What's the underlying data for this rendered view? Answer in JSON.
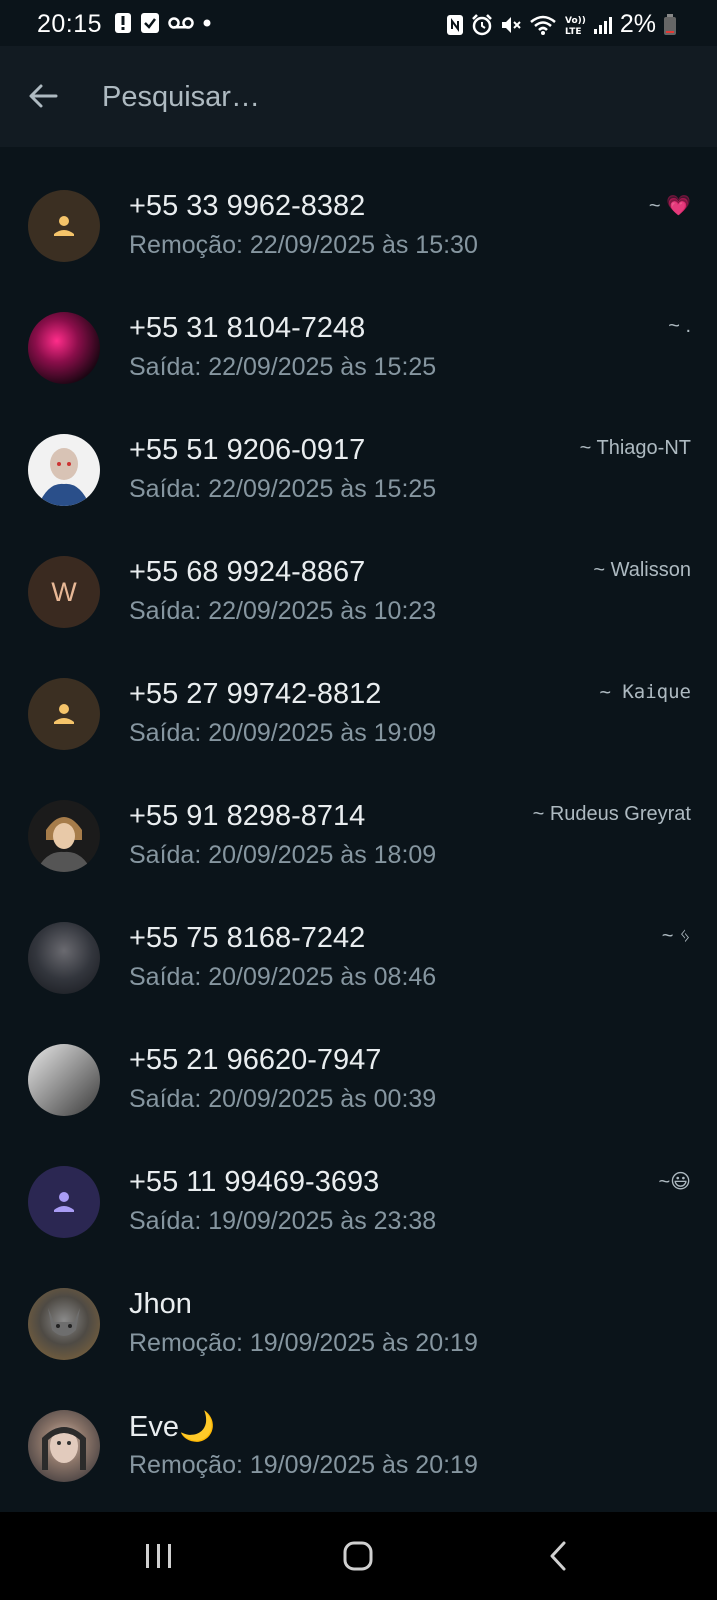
{
  "status_bar": {
    "time": "20:15",
    "battery": "2%",
    "left_icons": [
      "alert-icon",
      "check-box-icon",
      "voicemail-icon",
      "dot-icon"
    ],
    "right_icons": [
      "nfc-icon",
      "alarm-icon",
      "mute-icon",
      "wifi-icon",
      "volte-icon",
      "signal-icon",
      "battery-icon"
    ]
  },
  "search": {
    "placeholder": "Pesquisar…",
    "value": ""
  },
  "contacts": [
    {
      "name": "+55 33 9962-8382",
      "status": "Remoção: 22/09/2025 às 15:30",
      "push_name": "~ 💗",
      "avatar": "default-avatar"
    },
    {
      "name": "+55 31 8104-7248",
      "status": "Saída: 22/09/2025 às 15:25",
      "push_name": "~ .",
      "avatar": "photo-avatar"
    },
    {
      "name": "+55 51 9206-0917",
      "status": "Saída: 22/09/2025 às 15:25",
      "push_name": "~ Thiago-NT",
      "avatar": "photo-avatar"
    },
    {
      "name": "+55 68 9924-8867",
      "status": "Saída: 22/09/2025 às 10:23",
      "push_name": "~ Walisson",
      "avatar": "letter-avatar",
      "letter": "W"
    },
    {
      "name": "+55 27 99742-8812",
      "status": "Saída: 20/09/2025 às 19:09",
      "push_name": "~ Kaique",
      "avatar": "default-avatar"
    },
    {
      "name": "+55 91 8298-8714",
      "status": "Saída: 20/09/2025 às 18:09",
      "push_name": "~ Rudeus Greyrat",
      "avatar": "photo-avatar"
    },
    {
      "name": "+55 75 8168-7242",
      "status": "Saída: 20/09/2025 às 08:46",
      "push_name": "~ ᛃ",
      "avatar": "photo-avatar"
    },
    {
      "name": "+55 21 96620-7947",
      "status": "Saída: 20/09/2025 às 00:39",
      "push_name": "",
      "avatar": "photo-avatar"
    },
    {
      "name": "+55 11 99469-3693",
      "status": "Saída: 19/09/2025 às 23:38",
      "push_name": "~😃",
      "avatar": "default-avatar"
    },
    {
      "name": "Jhon",
      "status": "Remoção: 19/09/2025 às 20:19",
      "push_name": "",
      "avatar": "photo-avatar"
    },
    {
      "name": "Eve🌙",
      "status": "Remoção: 19/09/2025 às 20:19",
      "push_name": "",
      "avatar": "photo-avatar"
    }
  ],
  "colors": {
    "background": "#0b141a",
    "app_bar": "#121b22",
    "primary_text": "#e9edef",
    "secondary_text": "#8696a0",
    "default_avatar_bg": "#3b2f22",
    "default_avatar_icon": "#f5c46a",
    "purple_avatar_bg": "#2b2752",
    "purple_avatar_icon": "#a99cf5"
  },
  "nav": [
    "recent-apps-icon",
    "home-icon",
    "back-icon"
  ]
}
